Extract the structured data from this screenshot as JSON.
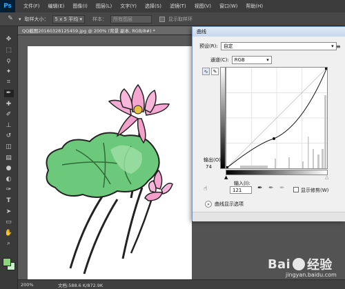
{
  "app": {
    "logo": "Ps"
  },
  "menu": [
    "文件(F)",
    "编辑(E)",
    "图像(I)",
    "图层(L)",
    "文字(Y)",
    "选择(S)",
    "滤镜(T)",
    "视图(V)",
    "窗口(W)",
    "帮助(H)"
  ],
  "options": {
    "sample_size_label": "取样大小：",
    "sample_size_value": "5 x 5 平均",
    "sample_label": "样本：",
    "sample_value": "所有图层",
    "show_ring_label": "显示取样环"
  },
  "document": {
    "tab_title": "QQ截图20160328125459.jpg @ 200% (背景 副本, RGB/8#) *",
    "zoom": "200%",
    "doc_size": "文档:588.6 K/872.9K"
  },
  "toolbar": {
    "tools": [
      "move-tool-icon",
      "marquee-tool-icon",
      "lasso-tool-icon",
      "quick-select-tool-icon",
      "crop-tool-icon",
      "eyedropper-tool-icon",
      "healing-brush-tool-icon",
      "brush-tool-icon",
      "clone-stamp-tool-icon",
      "history-brush-tool-icon",
      "eraser-tool-icon",
      "gradient-tool-icon",
      "blur-tool-icon",
      "dodge-tool-icon",
      "pen-tool-icon",
      "type-tool-icon",
      "path-select-tool-icon",
      "shape-tool-icon",
      "hand-tool-icon",
      "zoom-tool-icon"
    ],
    "fg_color": "#8bd67a",
    "bg_color": "#c8f0cc"
  },
  "curves": {
    "title": "曲线",
    "preset_label": "预设(R):",
    "preset_value": "自定",
    "channel_label": "通道(C):",
    "channel_value": "RGB",
    "output_label": "输出(O):",
    "output_value": "74",
    "input_label": "输入(I):",
    "input_value": "121",
    "show_clipping_label": "显示修剪(W)",
    "curve_options_label": "曲线显示选项",
    "curve_points": [
      [
        0,
        0
      ],
      [
        121,
        74
      ],
      [
        255,
        255
      ]
    ]
  },
  "watermark": {
    "main": "Bai",
    "main2": "经验",
    "sub": "jingyan.baidu.com"
  }
}
